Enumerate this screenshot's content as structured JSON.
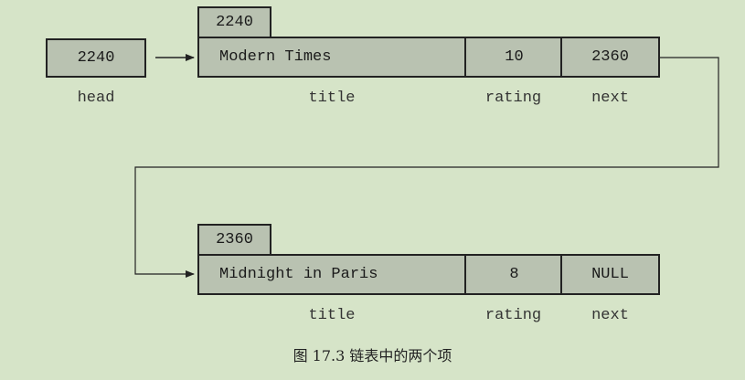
{
  "head": {
    "value": "2240",
    "label": "head"
  },
  "nodes": [
    {
      "address": "2240",
      "title": "Modern Times",
      "rating": "10",
      "next": "2360",
      "labels": {
        "title": "title",
        "rating": "rating",
        "next": "next"
      }
    },
    {
      "address": "2360",
      "title": "Midnight in Paris",
      "rating": "8",
      "next": "NULL",
      "labels": {
        "title": "title",
        "rating": "rating",
        "next": "next"
      }
    }
  ],
  "caption": "图 17.3    链表中的两个项"
}
